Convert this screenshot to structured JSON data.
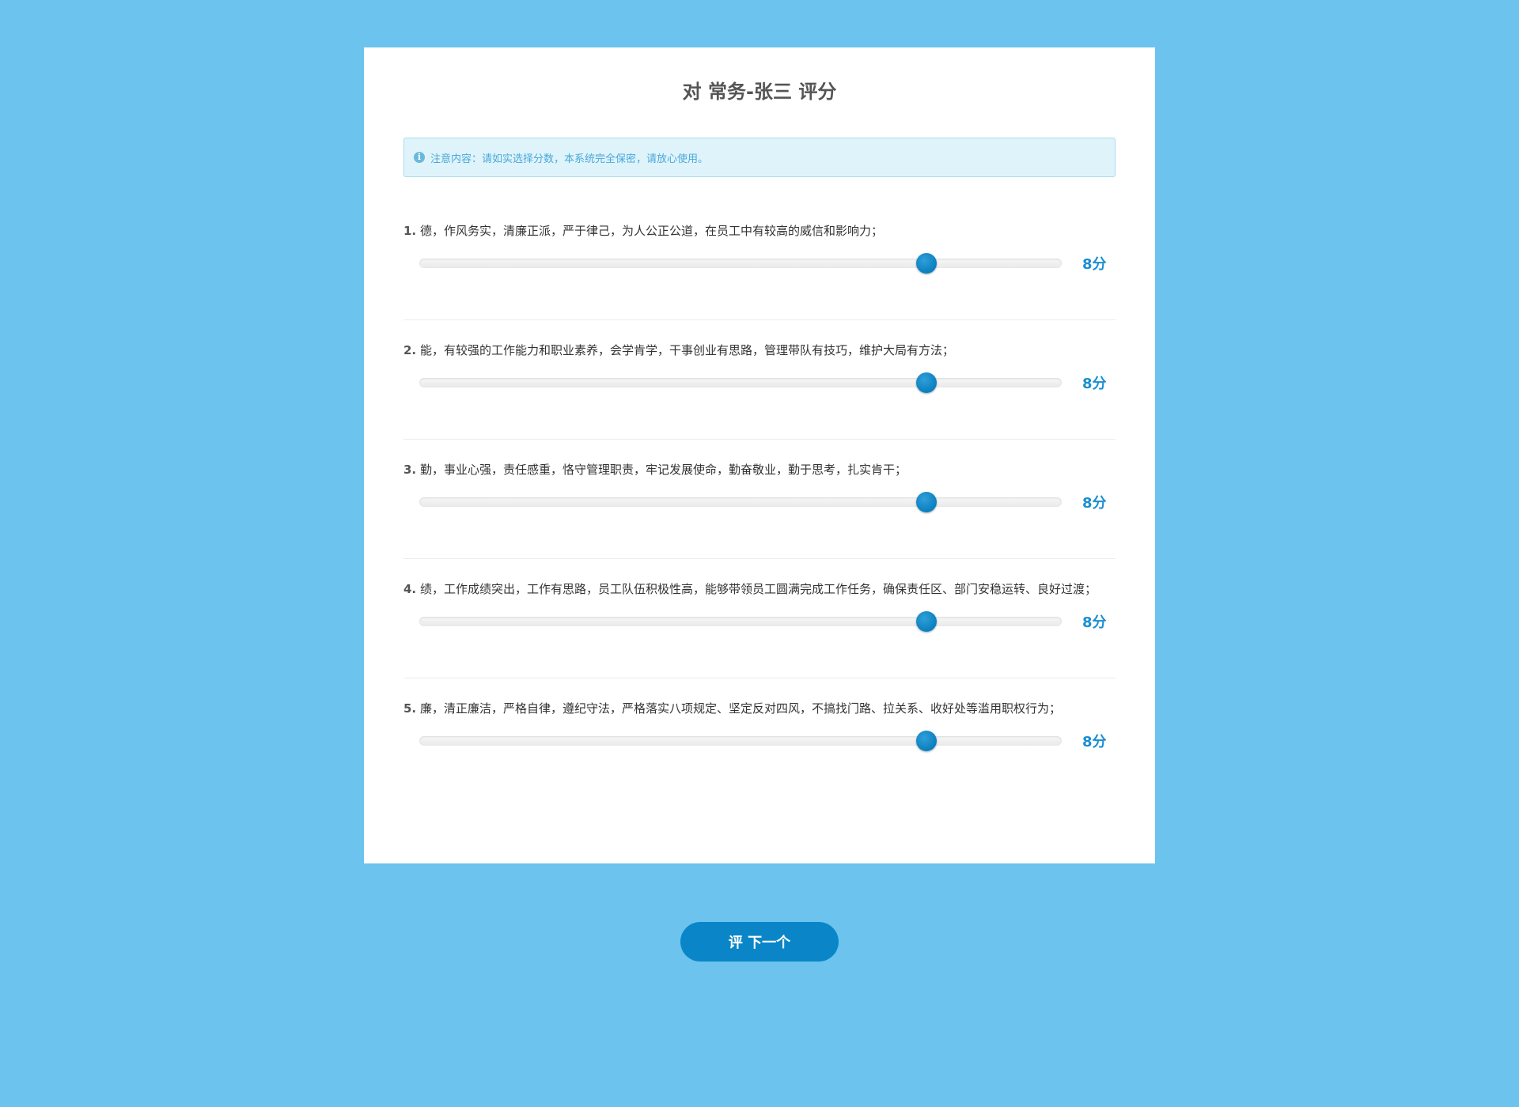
{
  "page": {
    "title": "对 常务-张三 评分"
  },
  "notice": {
    "icon": "info-icon",
    "text": "注意内容：请如实选择分数，本系统完全保密，请放心使用。"
  },
  "questions": [
    {
      "number": "1.",
      "text": "德，作风务实，清廉正派，严于律己，为人公正公道，在员工中有较高的威信和影响力；",
      "score_label": "8分",
      "score": 8,
      "slider_fraction": 0.79
    },
    {
      "number": "2.",
      "text": "能，有较强的工作能力和职业素养，会学肯学，干事创业有思路，管理带队有技巧，维护大局有方法；",
      "score_label": "8分",
      "score": 8,
      "slider_fraction": 0.79
    },
    {
      "number": "3.",
      "text": "勤，事业心强，责任感重，恪守管理职责，牢记发展使命，勤奋敬业，勤于思考，扎实肯干；",
      "score_label": "8分",
      "score": 8,
      "slider_fraction": 0.79
    },
    {
      "number": "4.",
      "text": "绩，工作成绩突出，工作有思路，员工队伍积极性高，能够带领员工圆满完成工作任务，确保责任区、部门安稳运转、良好过渡；",
      "score_label": "8分",
      "score": 8,
      "slider_fraction": 0.79
    },
    {
      "number": "5.",
      "text": "廉，清正廉洁，严格自律，遵纪守法，严格落实八项规定、坚定反对四风，不搞找门路、拉关系、收好处等滥用职权行为；",
      "score_label": "8分",
      "score": 8,
      "slider_fraction": 0.79
    }
  ],
  "actions": {
    "next_label": "评 下一个"
  },
  "colors": {
    "background": "#6bc3ee",
    "accent": "#0a86c8",
    "score": "#1a8ed0"
  }
}
